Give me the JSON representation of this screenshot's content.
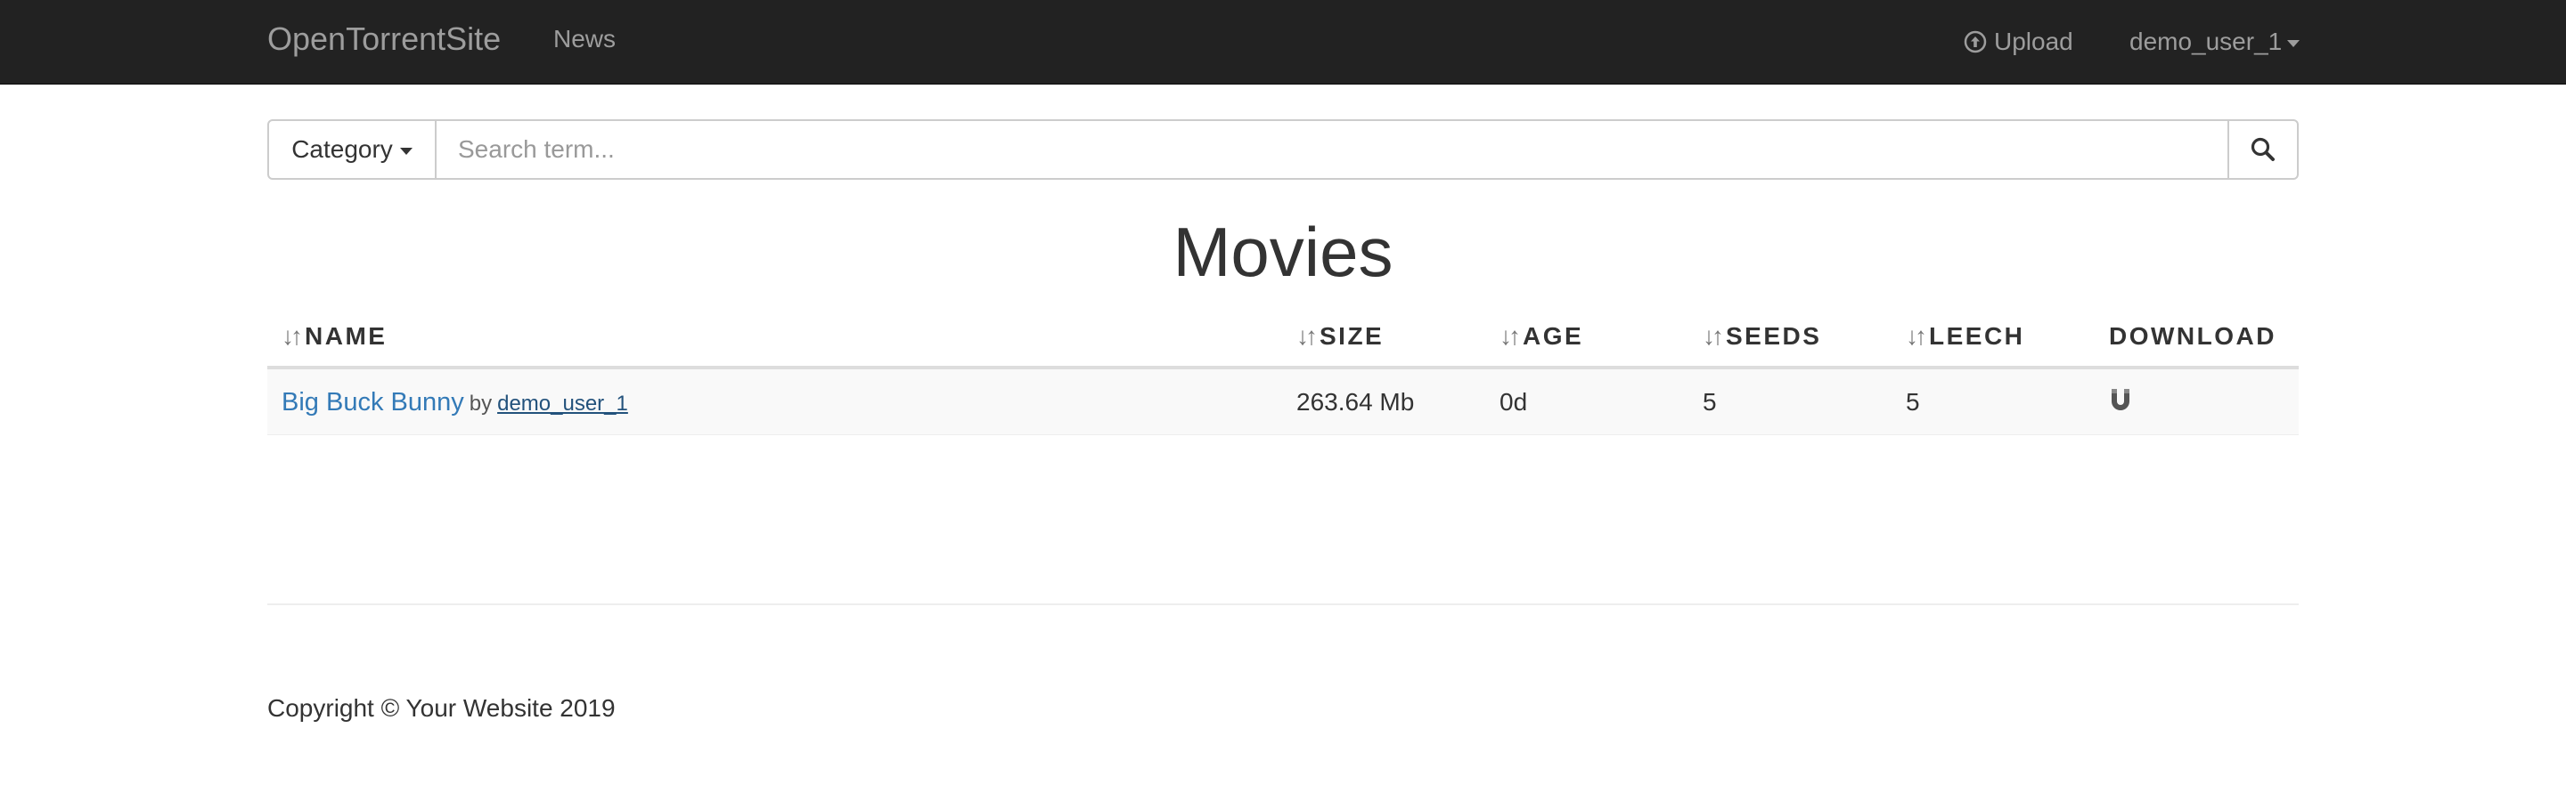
{
  "navbar": {
    "brand": "OpenTorrentSite",
    "news": "News",
    "upload": "Upload",
    "user": "demo_user_1",
    "icons": {
      "upload": "upload-circle-icon",
      "user_caret": "caret-down-icon"
    },
    "colors": {
      "background": "#222222",
      "link": "#9d9d9d"
    }
  },
  "search": {
    "category_label": "Category",
    "placeholder": "Search term...",
    "value": "",
    "icons": {
      "category_caret": "caret-down-icon",
      "submit": "search-icon"
    }
  },
  "page": {
    "title": "Movies"
  },
  "table": {
    "columns": [
      {
        "label": "NAME",
        "sortable": true
      },
      {
        "label": "SIZE",
        "sortable": true
      },
      {
        "label": "AGE",
        "sortable": true
      },
      {
        "label": "SEEDS",
        "sortable": true
      },
      {
        "label": "LEECH",
        "sortable": true
      },
      {
        "label": "DOWNLOAD",
        "sortable": false
      }
    ],
    "sort_icon": "sort-arrows-icon",
    "rows": [
      {
        "name": "Big Buck Bunny",
        "by": "by",
        "uploader": "demo_user_1",
        "size": "263.64 Mb",
        "age": "0d",
        "seeds": "5",
        "leech": "5",
        "download_icon": "magnet-icon"
      }
    ]
  },
  "footer": {
    "copyright": "Copyright © Your Website 2019"
  },
  "colors": {
    "link": "#337ab7",
    "row_stripe": "#f9f9f9",
    "border": "#dddddd"
  }
}
